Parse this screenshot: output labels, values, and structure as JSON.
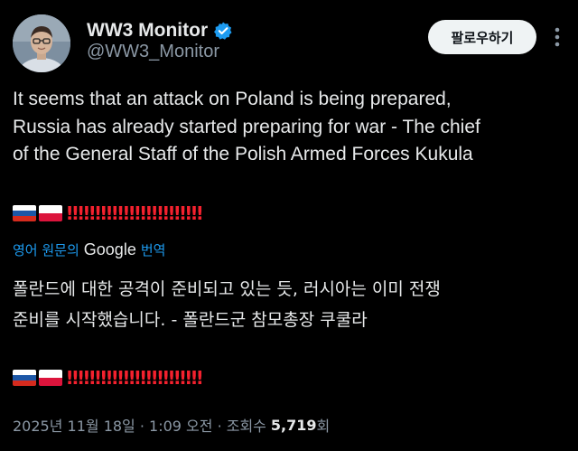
{
  "author": {
    "display_name": "WW3 Monitor",
    "handle": "@WW3_Monitor",
    "verified_icon": "verified-badge-icon",
    "verified_color": "#1d9bf0"
  },
  "actions": {
    "follow_label": "팔로우하기",
    "more_icon": "more-options-icon"
  },
  "tweet": {
    "text": "It seems that an attack on Poland is being prepared,\nRussia has already started preparing for war - The chief\nof the General Staff of the Polish Armed Forces Kukula",
    "emoji_flags": [
      "russia-flag-icon",
      "poland-flag-icon"
    ],
    "exclamations": "‼‼‼‼‼‼‼‼‼‼‼‼",
    "translate_prefix": "영어 원문의",
    "translate_provider": "Google",
    "translate_suffix": "번역",
    "translated_text": "폴란드에 대한 공격이 준비되고 있는 듯, 러시아는 이미 전쟁\n준비를 시작했습니다. - 폴란드군 참모총장 쿠쿨라"
  },
  "meta": {
    "timestamp": "2025년 11월 18일 · 1:09 오전 · 조회수",
    "views": "5,719",
    "views_suffix": "회"
  },
  "colors": {
    "background": "#000000",
    "text": "#e7e9ea",
    "secondary": "#8b98a5",
    "link": "#1d9bf0",
    "exclamation": "#f4212e"
  }
}
